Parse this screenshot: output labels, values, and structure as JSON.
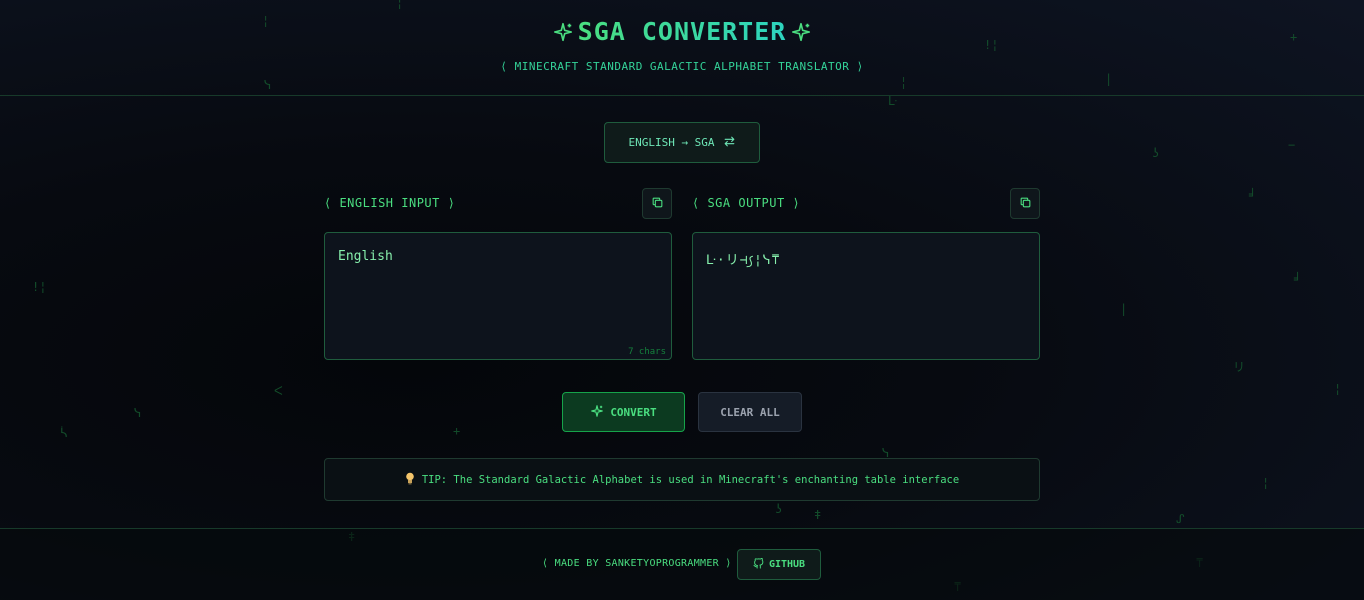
{
  "header": {
    "title": "SGA CONVERTER",
    "subtitle": "⟨ MINECRAFT STANDARD GALACTIC ALPHABET TRANSLATOR ⟩"
  },
  "mode": {
    "label": "ENGLISH → SGA",
    "icon": "swap-arrows-icon"
  },
  "input": {
    "label": "⟨ ENGLISH INPUT ⟩",
    "value": "English",
    "char_count": "7 chars"
  },
  "output": {
    "label": "⟨ SGA OUTPUT ⟩",
    "value": "ᒷ·リ⊣꠹¦ᓭ⍑"
  },
  "actions": {
    "convert_label": "CONVERT",
    "clear_label": "CLEAR ALL"
  },
  "tip": {
    "icon": "lightbulb-icon",
    "text": "TIP: The Standard Galactic Alphabet is used in Minecraft's enchanting table interface"
  },
  "footer": {
    "made_by": "⟨ MADE BY SANKETYOPROGRAMMER ⟩",
    "github_label": "GITHUB"
  },
  "colors": {
    "accent": "#4ade80",
    "accent_teal": "#2dd4bf",
    "background": "#070a10",
    "panel_border": "#1f5c3d"
  }
}
